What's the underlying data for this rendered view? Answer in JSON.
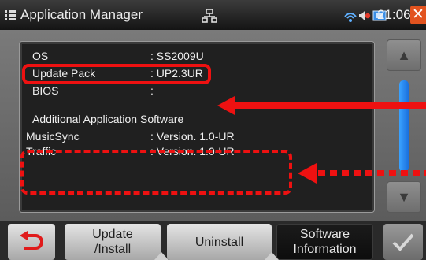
{
  "titlebar": {
    "app_icon": "app-manager-icon",
    "title": "Application Manager",
    "center_icon": "network-icon",
    "status_icons": [
      "signal-icon",
      "audio-icon",
      "battery-icon"
    ],
    "time": "21:06",
    "close_symbol": "✕"
  },
  "info": {
    "os_label": "OS",
    "os_value": ": SS2009U",
    "pack_label": "Update Pack",
    "pack_value": ": UP2.3UR",
    "bios_label": "BIOS",
    "bios_value": ":",
    "section_title": "Additional Application Software",
    "apps": [
      {
        "name": "MusicSync",
        "version": ": Version. 1.0-UR"
      },
      {
        "name": "Traffic",
        "version": ": Version. 1.0-UR"
      }
    ]
  },
  "scroll": {
    "up_symbol": "▲",
    "down_symbol": "▼"
  },
  "toolbar": {
    "back_icon": "back-arrow-icon",
    "update_label_1": "Update",
    "update_label_2": "/Install",
    "uninstall_label": "Uninstall",
    "info_label_1": "Software",
    "info_label_2": "Information",
    "ok_icon": "checkmark-icon"
  },
  "colors": {
    "accent_red": "#ee1111",
    "scroll_blue": "#2a86f0",
    "close_orange": "#e2531f"
  }
}
